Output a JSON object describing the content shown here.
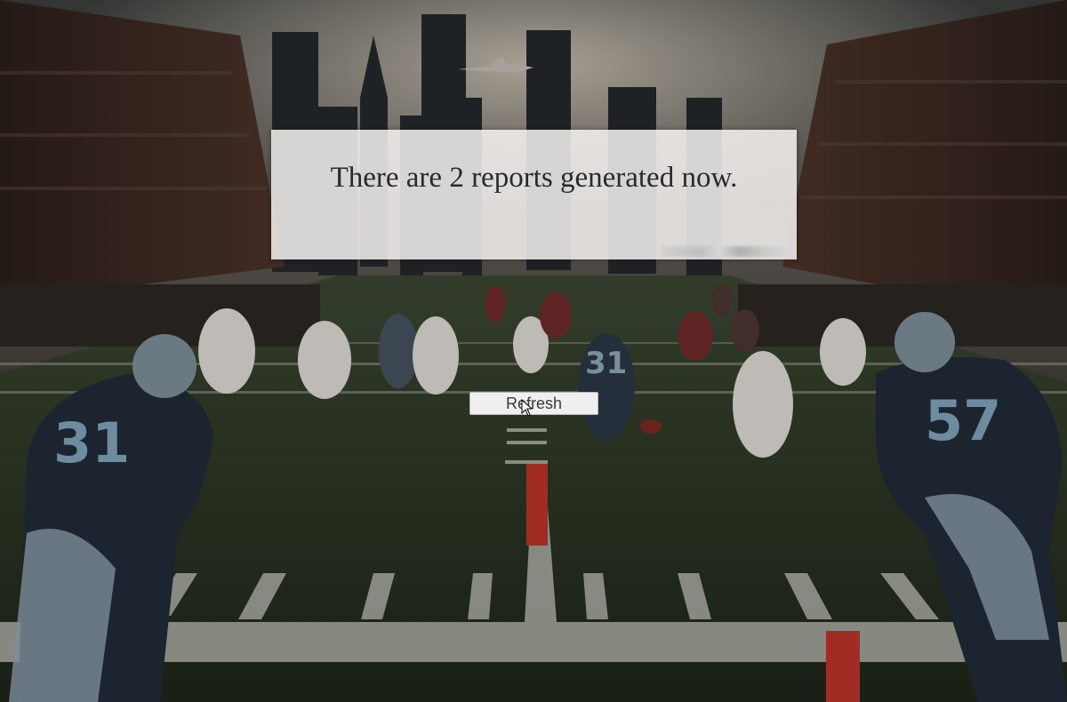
{
  "report": {
    "message": "There are 2 reports generated now."
  },
  "actions": {
    "refresh_label": "Refresh"
  },
  "scene": {
    "left_player_number": "31",
    "center_player_number": "31",
    "right_player_number": "57"
  },
  "colors": {
    "field_green": "#2e3a24",
    "jersey_dark": "#1f2a36",
    "jersey_light": "#d9d4cf",
    "marker_red": "#c0392b"
  }
}
